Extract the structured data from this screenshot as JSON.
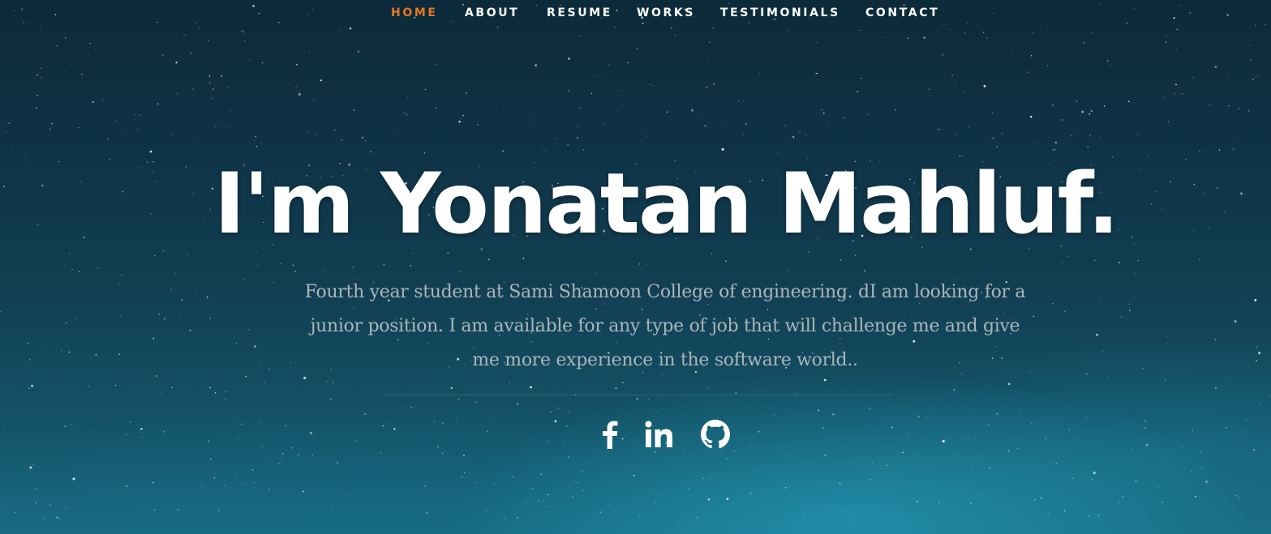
{
  "nav": {
    "items": [
      {
        "label": "HOME",
        "active": true
      },
      {
        "label": "ABOUT",
        "active": false
      },
      {
        "label": "RESUME",
        "active": false
      },
      {
        "label": "WORKS",
        "active": false
      },
      {
        "label": "TESTIMONIALS",
        "active": false
      },
      {
        "label": "CONTACT",
        "active": false
      }
    ],
    "active_color": "#e87625",
    "text_color": "#ffffff"
  },
  "hero": {
    "title": "I'm Yonatan Mahluf.",
    "description": "Fourth year student at Sami Shamoon College of engineering. dI am looking for a junior position. I am available for any type of job that will challenge me and give me more experience in the software world.."
  },
  "social": [
    {
      "icon": "facebook-icon"
    },
    {
      "icon": "linkedin-icon"
    },
    {
      "icon": "github-icon"
    }
  ],
  "colors": {
    "background_top": "#0c2a39",
    "background_bottom": "#1a6b82",
    "description_text": "#a9b6bb"
  }
}
